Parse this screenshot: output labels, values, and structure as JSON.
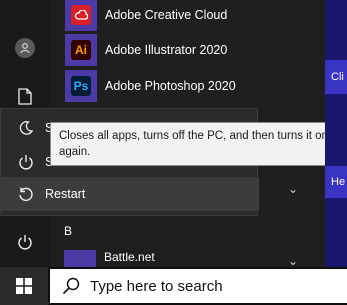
{
  "apps": [
    {
      "label": "Adobe Creative Cloud",
      "icon": "creative-cloud-icon",
      "bg": "#da1f26"
    },
    {
      "label": "Adobe Illustrator 2020",
      "icon": "illustrator-icon",
      "glyph": "Ai",
      "bg": "#330000",
      "fg": "#ff9a00"
    },
    {
      "label": "Adobe Photoshop 2020",
      "icon": "photoshop-icon",
      "glyph": "Ps",
      "bg": "#001e36",
      "fg": "#31a8ff"
    }
  ],
  "power_menu": {
    "sleep_label": "S",
    "shutdown_label": "S",
    "restart_label": "Restart"
  },
  "tooltip": {
    "text": "Closes all apps, turns off the PC, and then turns it on again."
  },
  "section_letter": "B",
  "partial_app_label": "Battle.net",
  "tiles": [
    {
      "label": "Cli"
    },
    {
      "label": "He"
    }
  ],
  "taskbar": {
    "search_placeholder": "Type here to search"
  },
  "colors": {
    "accent_tile": "#4c3aa6",
    "strip": "#19176e",
    "strip_tile": "#3a34c4"
  }
}
